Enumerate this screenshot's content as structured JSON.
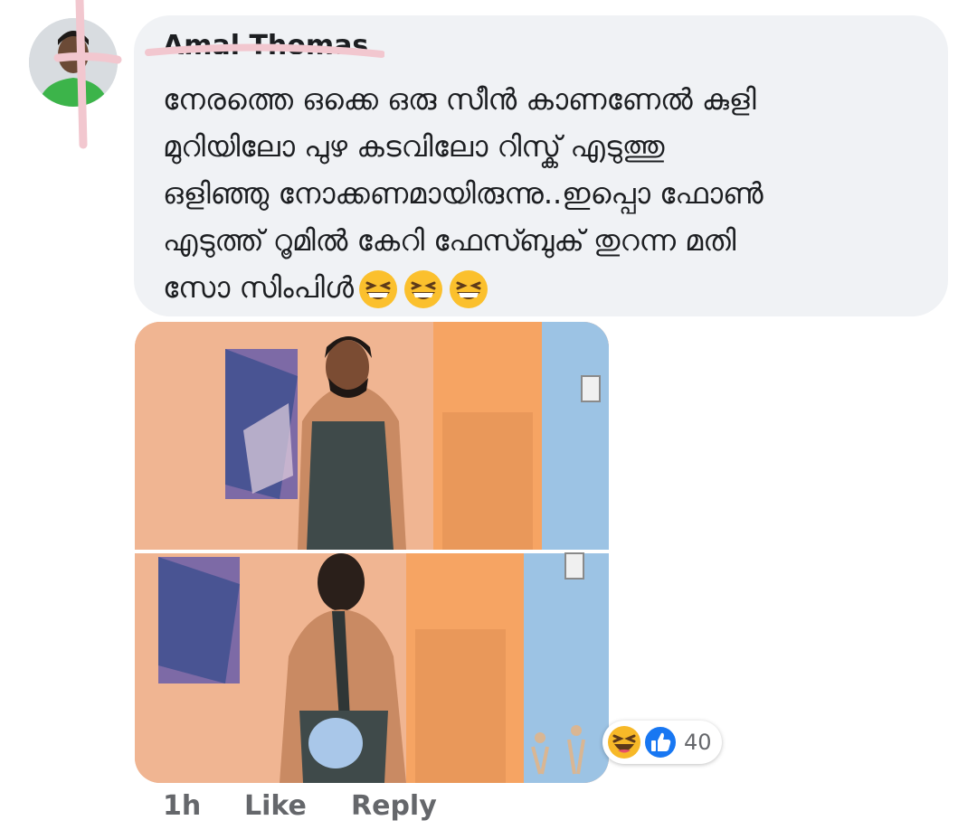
{
  "comment": {
    "author": "Amal Thomas",
    "text_lines": [
      "നേരത്തെ ഒക്കെ ഒരു സീൻ കാണണേൽ കുളി",
      "മുറിയിലോ പുഴ കടവിലോ റിസ്ക് എടുത്തു",
      "ഒളിഞ്ഞു നോക്കണമായിരുന്നു..ഇപ്പൊ ഫോൺ",
      "എടുത്ത് റൂമിൽ കേറി ഫേസ്ബുക് തുറന്ന മതി",
      "സോ സിംപിൾ"
    ],
    "trailing_emojis": [
      "grinning-squinting-face",
      "grinning-squinting-face",
      "grinning-squinting-face"
    ]
  },
  "reactions": {
    "types": [
      "haha",
      "like"
    ],
    "count": "40",
    "like_color": "#1877f2",
    "haha_color": "#f7b928"
  },
  "actions": {
    "time": "1h",
    "like": "Like",
    "reply": "Reply"
  },
  "colors": {
    "bubble": "#f0f2f5",
    "text": "#1c1e21",
    "meta_text": "#65676b"
  }
}
